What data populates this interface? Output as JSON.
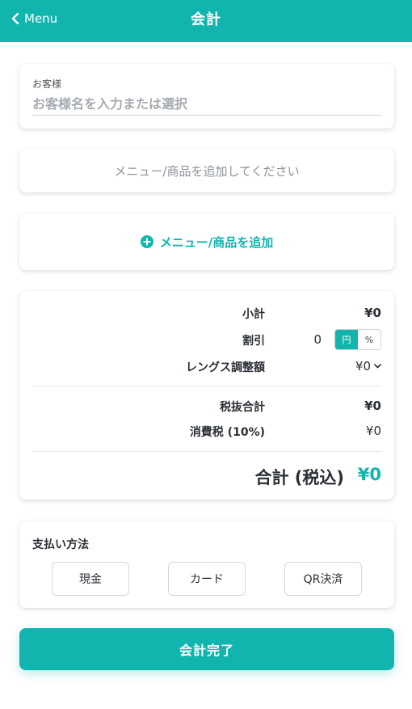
{
  "header": {
    "back_label": "Menu",
    "title": "会計"
  },
  "customer": {
    "label": "お客様",
    "placeholder": "お客様名を入力または選択",
    "value": ""
  },
  "items": {
    "empty_message": "メニュー/商品を追加してください"
  },
  "add_item": {
    "label": "メニュー/商品を追加"
  },
  "summary": {
    "subtotal_label": "小計",
    "subtotal_value": "¥0",
    "discount_label": "割引",
    "discount_value": "0",
    "discount_unit_yen": "円",
    "discount_unit_percent": "%",
    "discount_unit_selected": "円",
    "length_adjust_label": "レングス調整額",
    "length_adjust_value": "¥0",
    "pretax_total_label": "税抜合計",
    "pretax_total_value": "¥0",
    "tax_label": "消費税 (10%)",
    "tax_value": "¥0",
    "total_label": "合計 (税込)",
    "total_value": "¥0"
  },
  "payment": {
    "title": "支払い方法",
    "methods": [
      "現金",
      "カード",
      "QR決済"
    ]
  },
  "complete_button": {
    "label": "会計完了"
  },
  "colors": {
    "accent": "#11b5ad",
    "text": "#2b2f36",
    "muted": "#8d9299"
  }
}
